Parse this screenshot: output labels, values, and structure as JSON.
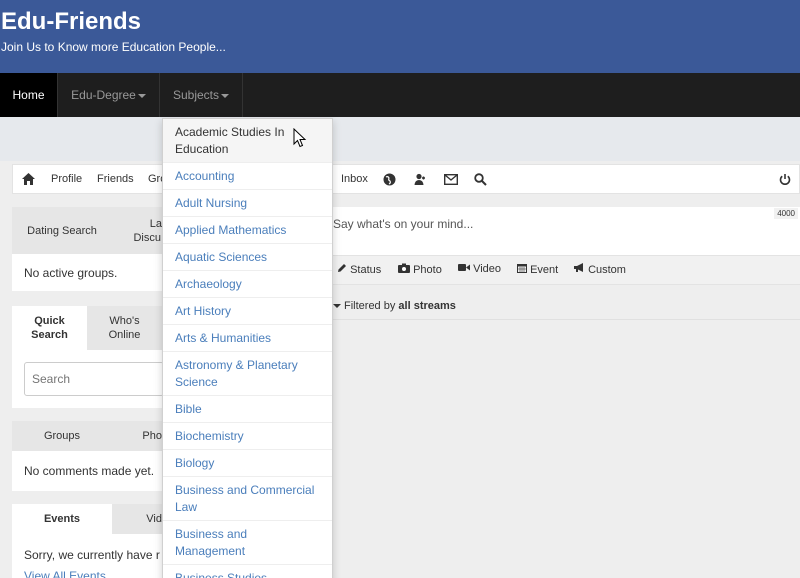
{
  "header": {
    "title": "Edu-Friends",
    "subtitle": "Join Us to Know more Education People..."
  },
  "nav": {
    "home": "Home",
    "degree": "Edu-Degree",
    "subjects": "Subjects"
  },
  "toolbar": {
    "profile": "Profile",
    "friends": "Friends",
    "groups_partial": "Gro",
    "inbox": "Inbox"
  },
  "widgets": {
    "tab_dating": "Dating Search",
    "tab_latest_a": "Lat",
    "tab_latest_b": "Discu",
    "no_groups": "No active groups.",
    "tab_quick_a": "Quick",
    "tab_quick_b": "Search",
    "tab_whos_a": "Who's",
    "tab_whos_b": "Online",
    "search_placeholder": "Search",
    "tab_groups": "Groups",
    "tab_photos": "Pho",
    "no_comments": "No comments made yet.",
    "tab_events": "Events",
    "tab_videos": "Vid",
    "events_sorry": "Sorry, we currently have r",
    "view_all_events": "View All Events"
  },
  "post": {
    "placeholder": "Say what's on your mind...",
    "char_count": "4000",
    "types": [
      "Status",
      "Photo",
      "Video",
      "Event",
      "Custom"
    ],
    "filter_prefix": "Filtered by ",
    "filter_value": "all streams"
  },
  "dropdown": {
    "items": [
      "Academic Studies In Education",
      "Accounting",
      "Adult Nursing",
      "Applied Mathematics",
      "Aquatic Sciences",
      "Archaeology",
      "Art History",
      "Arts & Humanities",
      "Astronomy & Planetary Science",
      "Bible",
      "Biochemistry",
      "Biology",
      "Business and Commercial Law",
      "Business and Management",
      "Business Studies"
    ]
  },
  "colors": {
    "header_bg": "#3b5998",
    "navbar_bg": "#1e1e1e",
    "link": "#4a7ebb"
  }
}
